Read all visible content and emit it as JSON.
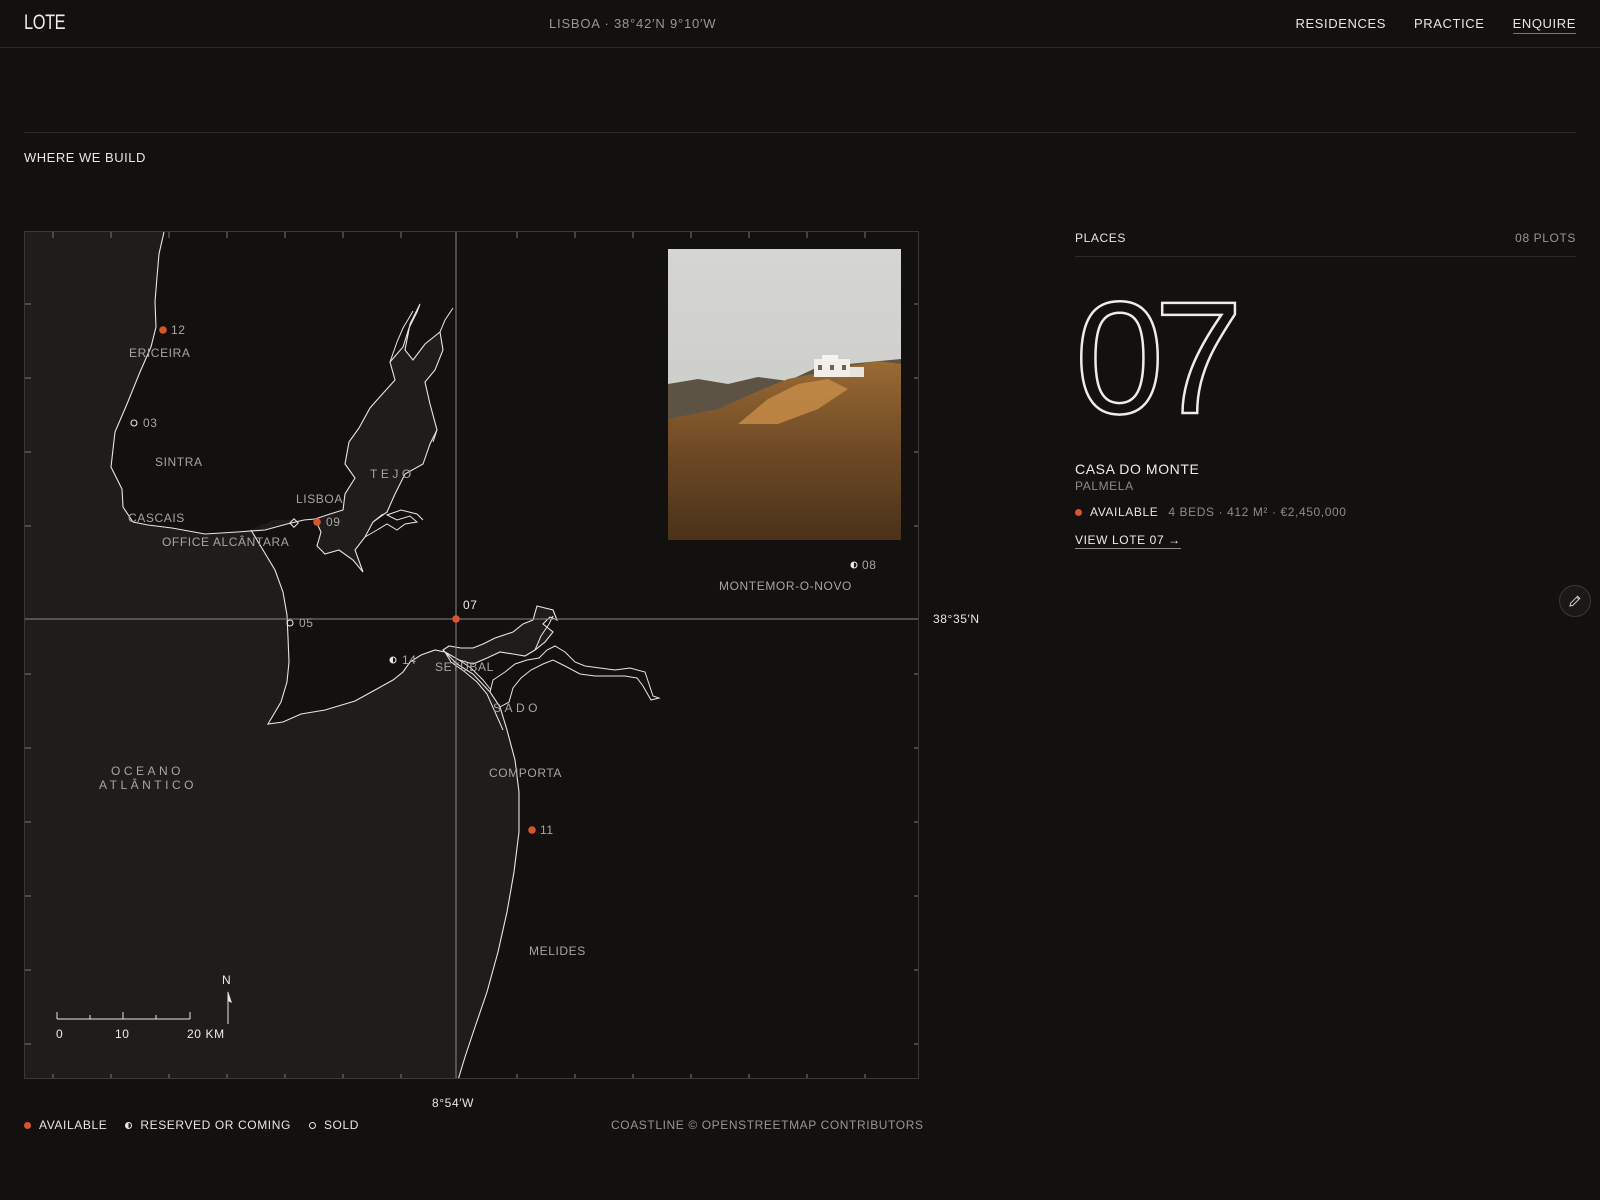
{
  "header": {
    "logo": "LOTE",
    "location": "LISBOA · 38°42′N 9°10′W",
    "nav": [
      {
        "label": "RESIDENCES",
        "active": false
      },
      {
        "label": "PRACTICE",
        "active": false
      },
      {
        "label": "ENQUIRE",
        "active": true
      }
    ]
  },
  "section": {
    "title": "WHERE WE BUILD"
  },
  "map": {
    "places": [
      "ERICEIRA",
      "SINTRA",
      "CASCAIS",
      "LISBOA",
      "OFFICE ALCÂNTARA",
      "TEJO",
      "MONTEMOR-O-NOVO",
      "SETÚBAL",
      "SADO",
      "COMPORTA",
      "MELIDES"
    ],
    "ocean": [
      "OCEANO",
      "ATLÂNTICO"
    ],
    "plots": [
      {
        "num": "12",
        "status": "available"
      },
      {
        "num": "03",
        "status": "sold"
      },
      {
        "num": "09",
        "status": "available"
      },
      {
        "num": "05",
        "status": "sold"
      },
      {
        "num": "07",
        "status": "available",
        "selected": true
      },
      {
        "num": "14",
        "status": "reserved"
      },
      {
        "num": "08",
        "status": "reserved"
      },
      {
        "num": "11",
        "status": "available"
      }
    ],
    "latitude": "38°35′N",
    "longitude": "8°54′W",
    "scale": {
      "ticks": [
        "0",
        "10",
        "20 KM"
      ]
    },
    "north": "N",
    "credit": "COASTLINE © OPENSTREETMAP CONTRIBUTORS",
    "legend": {
      "available": "AVAILABLE",
      "reserved": "RESERVED OR COMING",
      "sold": "SOLD"
    }
  },
  "panel": {
    "title": "PLACES",
    "count": "08 PLOTS",
    "selected": {
      "number": "07",
      "name": "CASA DO MONTE",
      "place": "PALMELA",
      "status": "AVAILABLE",
      "specs": "4 BEDS · 412 M² · €2,450,000",
      "link": "VIEW LOTE 07 →"
    }
  },
  "colors": {
    "background": "#121110",
    "land": "#121110",
    "sea": "#1e1d1c",
    "accent": "#d9542c",
    "text": "#e9e6df",
    "muted": "#9a968f"
  },
  "icons": {
    "edit": "pencil-icon",
    "north": "north-arrow-icon"
  }
}
